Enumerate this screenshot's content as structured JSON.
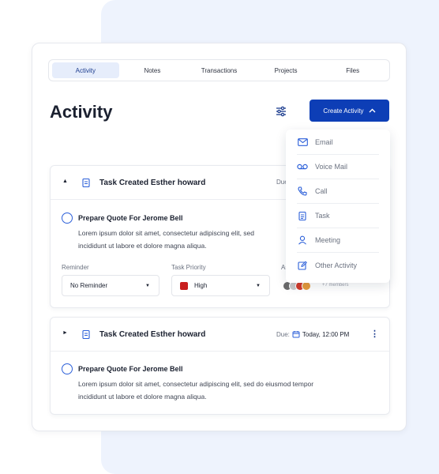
{
  "tabs": [
    {
      "label": "Activity",
      "active": true
    },
    {
      "label": "Notes"
    },
    {
      "label": "Transactions"
    },
    {
      "label": "Projects"
    },
    {
      "label": "Files"
    }
  ],
  "page_title": "Activity",
  "create_button": {
    "label": "Create Activity",
    "icon": "chevron-up-icon"
  },
  "filter_icon": "sliders-icon",
  "dropdown": {
    "items": [
      {
        "label": "Email",
        "icon": "mail-icon"
      },
      {
        "label": "Voice Mail",
        "icon": "voicemail-icon"
      },
      {
        "label": "Call",
        "icon": "phone-icon"
      },
      {
        "label": "Task",
        "icon": "clipboard-icon"
      },
      {
        "label": "Meeting",
        "icon": "user-icon"
      },
      {
        "label": "Other Activity",
        "icon": "edit-icon"
      }
    ]
  },
  "tasks": [
    {
      "title": "Task Created Esther howard",
      "due_label": "Due:",
      "item_title": "Prepare Quote For Jerome Bell",
      "item_desc_1": "Lorem ipsum dolor sit amet, consectetur adipiscing elit, sed",
      "item_desc_2": "incididunt ut labore et dolore magna aliqua.",
      "reminder_label": "Reminder",
      "reminder_value": "No Reminder",
      "priority_label": "Task Priority",
      "priority_value": "High",
      "priority_color": "#c81e1e",
      "assignee_label": "As",
      "members": "+7 members"
    },
    {
      "title": "Task Created Esther howard",
      "due_label": "Due:",
      "due_value": "Today, 12:00 PM",
      "item_title": "Prepare Quote For Jerome Bell",
      "item_desc_1": "Lorem ipsum dolor sit amet, consectetur adipiscing elit, sed do eiusmod tempor",
      "item_desc_2": "incididunt ut labore et dolore magna aliqua."
    }
  ],
  "colors": {
    "accent": "#0d3eb6",
    "accent_light": "#e6edfb",
    "background_panel": "#eef3fd"
  }
}
